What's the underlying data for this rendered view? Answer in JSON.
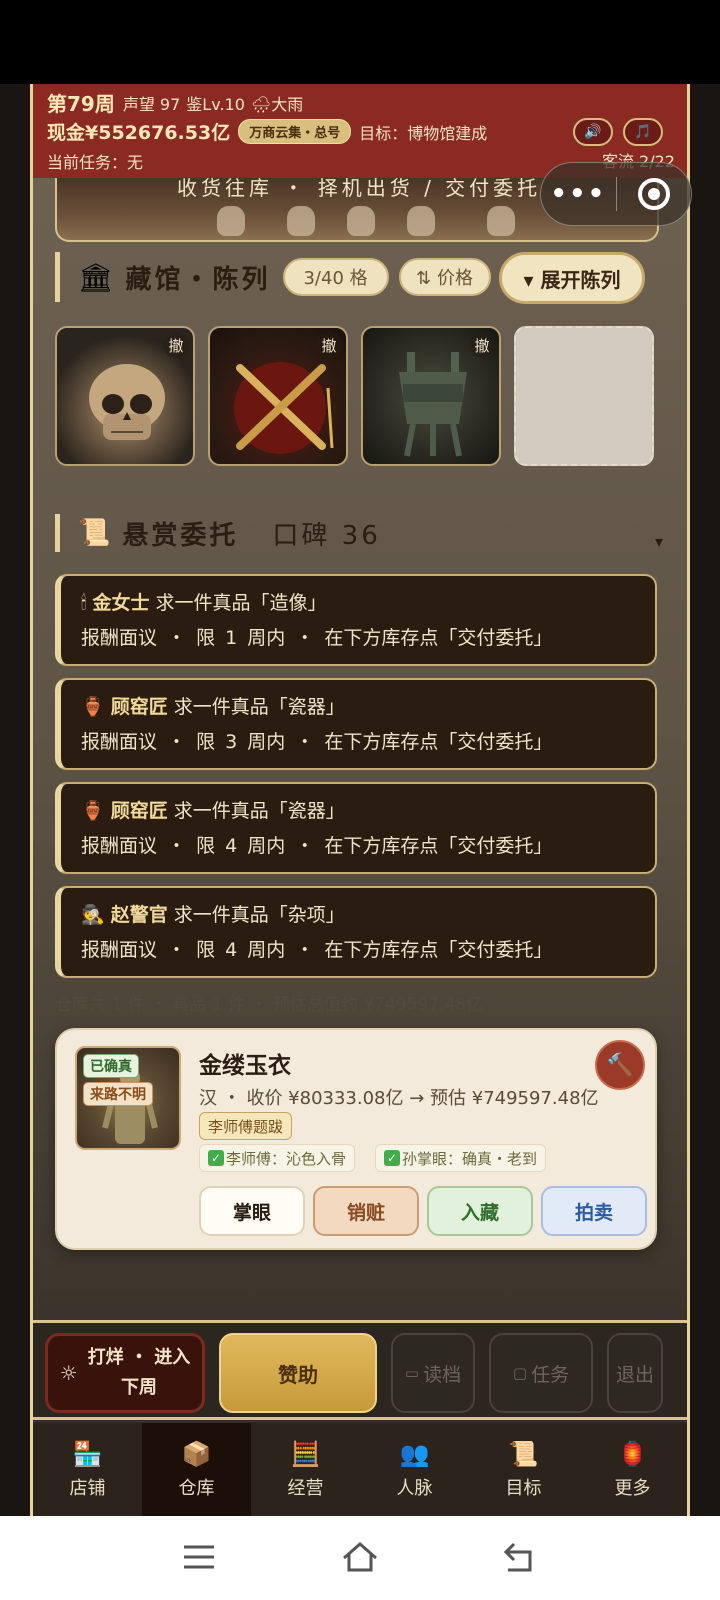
{
  "header": {
    "week": "第79周",
    "reputation": "声望 97",
    "appraisal_level": "鉴Lv.10",
    "weather": "🌧大雨",
    "cash": "现金¥552676.53亿",
    "shop_badge": "万商云集・总号",
    "goal": "目标：博物馆建成",
    "sound_icon": "🔊",
    "music_icon": "🎵",
    "current_task": "当前任务：无",
    "guest_flow": "客流 2/22"
  },
  "banner": {
    "text": "收货往库 ・ 择机出货 / 交付委托"
  },
  "exhibit": {
    "icon": "🏛",
    "title": "藏馆・陈列",
    "capacity": "3/40 格",
    "sort": "⇅ 价格",
    "expand": "▾ 展开陈列",
    "remove_label": "撤",
    "items": [
      "skull",
      "crossed-swords",
      "bronze-ding",
      "empty-slot"
    ]
  },
  "bounty": {
    "icon": "📜",
    "title": "悬赏委托",
    "reputation": "口碑 36",
    "caret": "▾",
    "entries": [
      {
        "icon": "🕯",
        "client": "金女士",
        "request": "求一件真品「造像」",
        "terms": "报酬面议 ・ 限 1 周内 ・ 在下方库存点「交付委托」"
      },
      {
        "icon": "🏺",
        "client": "顾窑匠",
        "request": "求一件真品「瓷器」",
        "terms": "报酬面议 ・ 限 3 周内 ・ 在下方库存点「交付委托」"
      },
      {
        "icon": "🏺",
        "client": "顾窑匠",
        "request": "求一件真品「瓷器」",
        "terms": "报酬面议 ・ 限 4 周内 ・ 在下方库存点「交付委托」"
      },
      {
        "icon": "🕵",
        "client": "赵警官",
        "request": "求一件真品「杂项」",
        "terms": "报酬面议 ・ 限 4 周内 ・ 在下方库存点「交付委托」"
      }
    ]
  },
  "warehouse_summary": "仓库共 1 件 ・ 真品 1 件 ・ 预估总值约 ¥749597.48亿",
  "item_card": {
    "tag_authentic": "已确真",
    "tag_provenance": "来路不明",
    "name": "金缕玉衣",
    "meta": "汉 ・ 收价 ¥80333.08亿 → 预估 ¥749597.48亿",
    "master_badge": "李师傅题跋",
    "note1": "李师傅：沁色入骨",
    "note2": "孙掌眼：确真・老到",
    "hammer_icon": "🔨",
    "actions": {
      "appraise": "掌眼",
      "fence": "销赃",
      "collect": "入藏",
      "auction": "拍卖"
    }
  },
  "action_bar": {
    "next_week_icon": "☼",
    "next_week_line1": "打烊 ・ 进入",
    "next_week_line2": "下周",
    "sponsor": "赞助",
    "load": "读档",
    "task": "任务",
    "exit": "退出"
  },
  "tabs": [
    {
      "icon": "🏪",
      "label": "店铺"
    },
    {
      "icon": "📦",
      "label": "仓库"
    },
    {
      "icon": "🧮",
      "label": "经营"
    },
    {
      "icon": "👥",
      "label": "人脉"
    },
    {
      "icon": "📜",
      "label": "目标"
    },
    {
      "icon": "🏮",
      "label": "更多"
    }
  ],
  "colors": {
    "header_red": "#8b2a22",
    "gold": "#e7d39a",
    "card_bg": "#f3eadb",
    "bounty_bg": "#2a1c10"
  }
}
